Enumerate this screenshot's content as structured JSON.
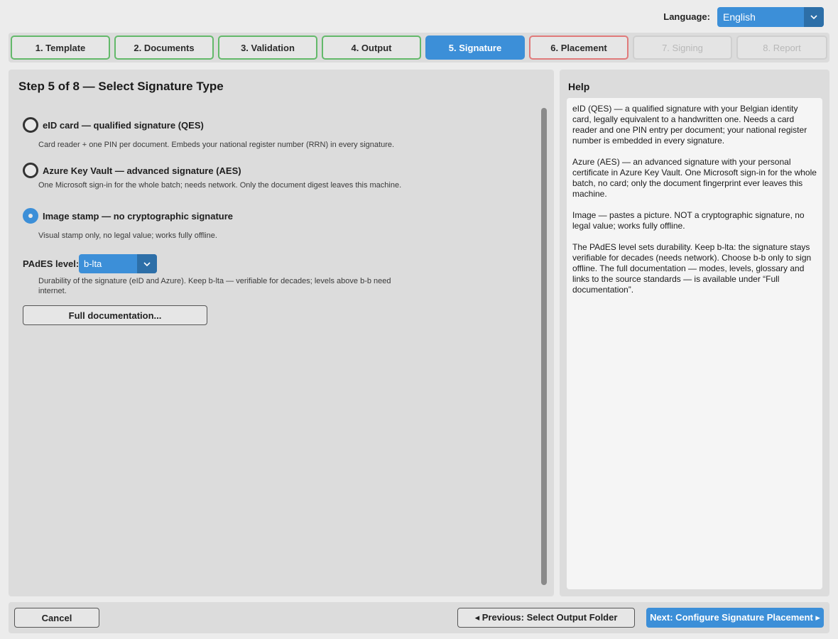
{
  "language": {
    "label": "Language:",
    "value": "English",
    "icon": "chevron-down-icon"
  },
  "steps": [
    {
      "label": "1. Template",
      "state": "done"
    },
    {
      "label": "2. Documents",
      "state": "done"
    },
    {
      "label": "3. Validation",
      "state": "done"
    },
    {
      "label": "4. Output",
      "state": "done"
    },
    {
      "label": "5. Signature",
      "state": "active"
    },
    {
      "label": "6. Placement",
      "state": "warning"
    },
    {
      "label": "7. Signing",
      "state": "disabled"
    },
    {
      "label": "8. Report",
      "state": "disabled"
    }
  ],
  "main": {
    "title": "Step 5 of 8 — Select Signature Type",
    "options": [
      {
        "label": "eID card — qualified signature (QES)",
        "description": "Card reader + one PIN per document. Embeds your national register number (RRN) in every signature.",
        "checked": false
      },
      {
        "label": "Azure Key Vault — advanced signature (AES)",
        "description": "One Microsoft sign-in for the whole batch; needs network. Only the document digest leaves this machine.",
        "checked": false
      },
      {
        "label": "Image stamp — no cryptographic signature",
        "description": "Visual stamp only, no legal value; works fully offline.",
        "checked": true
      }
    ],
    "pades": {
      "label": "PAdES level:",
      "value": "b-lta",
      "description": "Durability of the signature (eID and Azure). Keep b-lta — verifiable for decades; levels above b-b need internet."
    },
    "doc_button": "Full documentation..."
  },
  "help": {
    "title": "Help",
    "paragraphs": [
      "eID (QES) — a qualified signature with your Belgian identity card, legally equivalent to a handwritten one. Needs a card reader and one PIN entry per document; your national register number is embedded in every signature.",
      "Azure (AES) — an advanced signature with your personal certificate in Azure Key Vault. One Microsoft sign-in for the whole batch, no card; only the document fingerprint ever leaves this machine.",
      "Image — pastes a picture. NOT a cryptographic signature, no legal value; works fully offline.",
      "The PAdES level sets durability. Keep b-lta: the signature stays verifiable for decades (needs network). Choose b-b only to sign offline. The full documentation — modes, levels, glossary and links to the source standards — is available under “Full documentation”."
    ]
  },
  "footer": {
    "cancel": "Cancel",
    "previous": "◂ Previous: Select Output Folder",
    "next": "Next: Configure Signature Placement ▸"
  },
  "colors": {
    "accent": "#3c8fd8",
    "done_border": "#63b96a",
    "warning_border": "#e07a7a"
  }
}
